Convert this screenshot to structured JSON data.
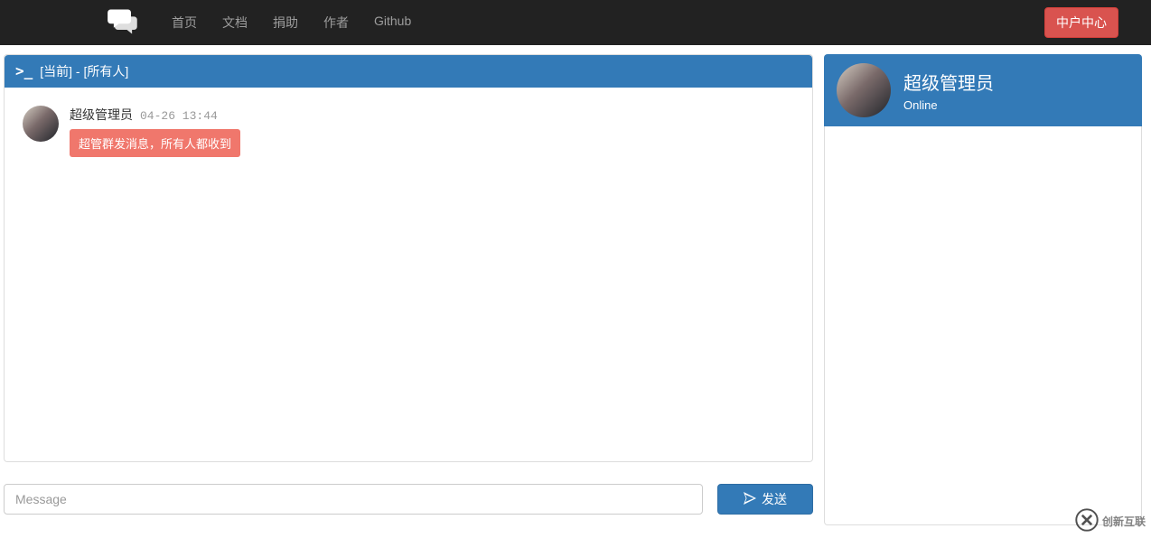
{
  "navbar": {
    "links": [
      "首页",
      "文档",
      "捐助",
      "作者",
      "Github"
    ],
    "user_center_label": "中户中心"
  },
  "chat": {
    "header_title": "[当前] - [所有人]",
    "messages": [
      {
        "name": "超级管理员",
        "time": "04-26 13:44",
        "text": "超管群发消息，所有人都收到"
      }
    ],
    "compose_placeholder": "Message",
    "send_label": "发送"
  },
  "sidebar": {
    "title": "超级管理员",
    "status": "Online"
  },
  "watermark": {
    "text": "创新互联"
  }
}
